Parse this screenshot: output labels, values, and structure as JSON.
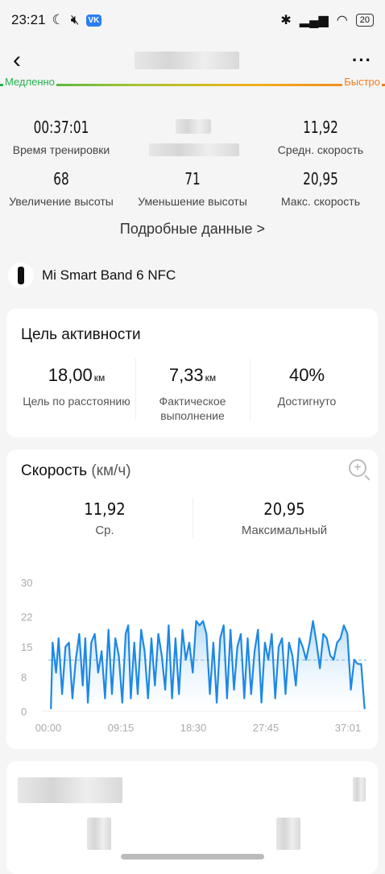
{
  "status": {
    "time": "23:21",
    "vk": "VK",
    "battery": "20"
  },
  "nav": {
    "back_glyph": "‹",
    "more_glyph": "···"
  },
  "pace_bar": {
    "slow": "Медленно",
    "fast": "Быстро"
  },
  "stats": [
    {
      "value": "00:37:01",
      "label": "Время тренировки"
    },
    {
      "value": "11,92",
      "label": "Средн. скорость"
    },
    {
      "value": "68",
      "label": "Увеличение высоты"
    },
    {
      "value": "71",
      "label": "Уменьшение высоты"
    },
    {
      "value": "20,95",
      "label": "Макс. скорость"
    }
  ],
  "details_link": "Подробные данные  >",
  "device_name": "Mi Smart Band 6 NFC",
  "goal": {
    "title": "Цель активности",
    "items": [
      {
        "value": "18,00",
        "unit": "км",
        "label": "Цель по расстоянию"
      },
      {
        "value": "7,33",
        "unit": "км",
        "label": "Фактическое выполнение"
      },
      {
        "value": "40%",
        "unit": "",
        "label": "Достигнуто"
      }
    ]
  },
  "speed": {
    "title": "Скорость",
    "unit": "(км/ч)",
    "avg_value": "11,92",
    "avg_label": "Ср.",
    "max_value": "20,95",
    "max_label": "Максимальный"
  },
  "chart_data": {
    "type": "area",
    "title": "Скорость (км/ч)",
    "x_tick_labels": [
      "00:00",
      "09:15",
      "18:30",
      "27:45",
      "37:01"
    ],
    "y_tick_labels": [
      "30",
      "22",
      "15",
      "8",
      "0"
    ],
    "y_ticks": [
      30,
      22,
      15,
      8,
      0
    ],
    "ylim": [
      0,
      30
    ],
    "xlim_minutes": [
      0,
      37.02
    ],
    "average_line": 11.92,
    "line_color": "#1e88e5",
    "series": [
      {
        "x": [
          0.3,
          0.5,
          0.9,
          1.2,
          1.6,
          2.0,
          2.4,
          2.8,
          3.2,
          3.6,
          4.0,
          4.3,
          4.6,
          5.0,
          5.4,
          5.8,
          6.2,
          6.6,
          7.0,
          7.4,
          7.8,
          8.2,
          8.6,
          9.0,
          9.3,
          9.6,
          10.0,
          10.4,
          10.8,
          11.2,
          11.6,
          12.0,
          12.4,
          12.8,
          13.2,
          13.6,
          14.0,
          14.4,
          14.8,
          15.2,
          15.6,
          16.0,
          16.4,
          16.8,
          17.2,
          17.6,
          18.0,
          18.4,
          18.8,
          19.2,
          19.6,
          20.0,
          20.4,
          20.8,
          21.2,
          21.6,
          22.0,
          22.4,
          22.8,
          23.2,
          23.6,
          24.0,
          24.4,
          24.8,
          25.2,
          25.6,
          26.0,
          26.4,
          26.8,
          27.2,
          27.6,
          28.0,
          28.4,
          28.8,
          29.2,
          29.6,
          30.0,
          30.4,
          30.8,
          31.2,
          31.6,
          32.0,
          32.4,
          32.8,
          33.2,
          33.6,
          34.0,
          34.4,
          34.8,
          35.2,
          35.6,
          36.0,
          36.4,
          36.8
        ],
        "y": [
          0.5,
          16,
          9,
          17,
          4,
          15,
          16,
          3,
          12,
          18,
          6,
          17,
          2,
          16,
          18,
          9,
          14,
          3,
          19,
          4,
          17,
          13,
          2,
          18,
          20,
          3,
          16,
          4,
          19,
          14,
          3,
          17,
          6,
          18,
          13,
          5,
          20,
          3,
          17,
          4,
          19,
          12,
          16,
          9,
          21,
          20,
          21,
          18,
          4,
          16,
          2,
          17,
          20,
          3,
          19,
          5,
          15,
          18,
          3,
          17,
          4,
          14,
          19,
          2,
          16,
          12,
          18,
          3,
          15,
          17,
          4,
          16,
          13,
          6,
          17,
          15,
          12,
          16,
          21,
          16,
          10,
          18,
          17,
          13,
          12,
          16,
          17,
          20,
          18,
          5,
          12,
          11,
          11,
          0.5
        ]
      }
    ]
  }
}
